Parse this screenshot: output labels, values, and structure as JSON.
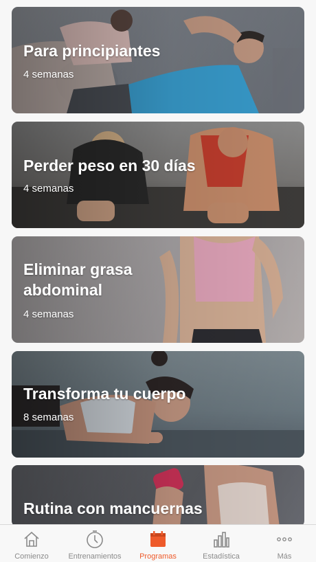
{
  "programs": [
    {
      "title": "Para principiantes",
      "duration": "4 semanas"
    },
    {
      "title": "Perder peso en 30 días",
      "duration": "4 semanas"
    },
    {
      "title": "Eliminar grasa abdominal",
      "duration": "4 semanas"
    },
    {
      "title": "Transforma tu cuerpo",
      "duration": "8 semanas"
    },
    {
      "title": "Rutina con mancuernas",
      "duration": ""
    }
  ],
  "tabbar": {
    "tabs": [
      {
        "label": "Comienzo",
        "icon": "home-icon"
      },
      {
        "label": "Entrenamientos",
        "icon": "stopwatch-icon"
      },
      {
        "label": "Programas",
        "icon": "calendar-icon"
      },
      {
        "label": "Estadística",
        "icon": "bar-chart-icon"
      },
      {
        "label": "Más",
        "icon": "more-icon"
      }
    ],
    "active_index": 2,
    "active_color": "#ee5a2a",
    "inactive_color": "#8a8a8a"
  }
}
